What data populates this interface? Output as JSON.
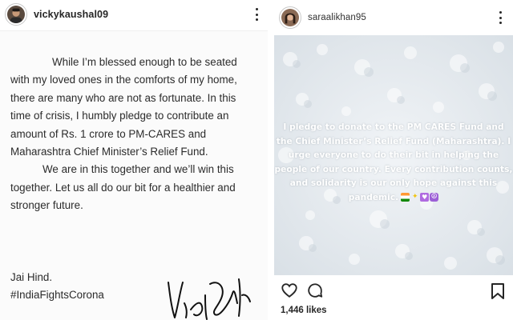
{
  "left_post": {
    "username": "vickykaushal09",
    "letter_paragraphs": [
      "While I’m blessed enough to be seated with my loved ones in the comforts of my home, there are many who are not as fortunate. In this time of crisis, I humbly pledge to contribute an amount of Rs. 1 crore to PM-CARES and Maharashtra Chief Minister’s Relief Fund.",
      "We are in this together and we’ll win this together. Let us all do our bit for a healthier and stronger future."
    ],
    "signoff": "Jai Hind.",
    "hashtag": "#IndiaFightsCorona"
  },
  "right_post": {
    "username": "saraalikhan95",
    "image_text": "I pledge to donate to the PM CARES Fund and the Chief Minister’s Relief Fund (Maharashtra). I urge everyone to do their bit in helping the people of our country. Every contribution counts, and solidarity is our only hope against this pandemic.",
    "likes": "1,446 likes"
  },
  "icons": {
    "more": "more-options-icon",
    "like": "heart-icon",
    "comment": "comment-icon",
    "bookmark": "bookmark-icon"
  },
  "colors": {
    "text": "#262626",
    "snow": "#e7ecf0",
    "letter_bg": "#fbfbfb"
  }
}
